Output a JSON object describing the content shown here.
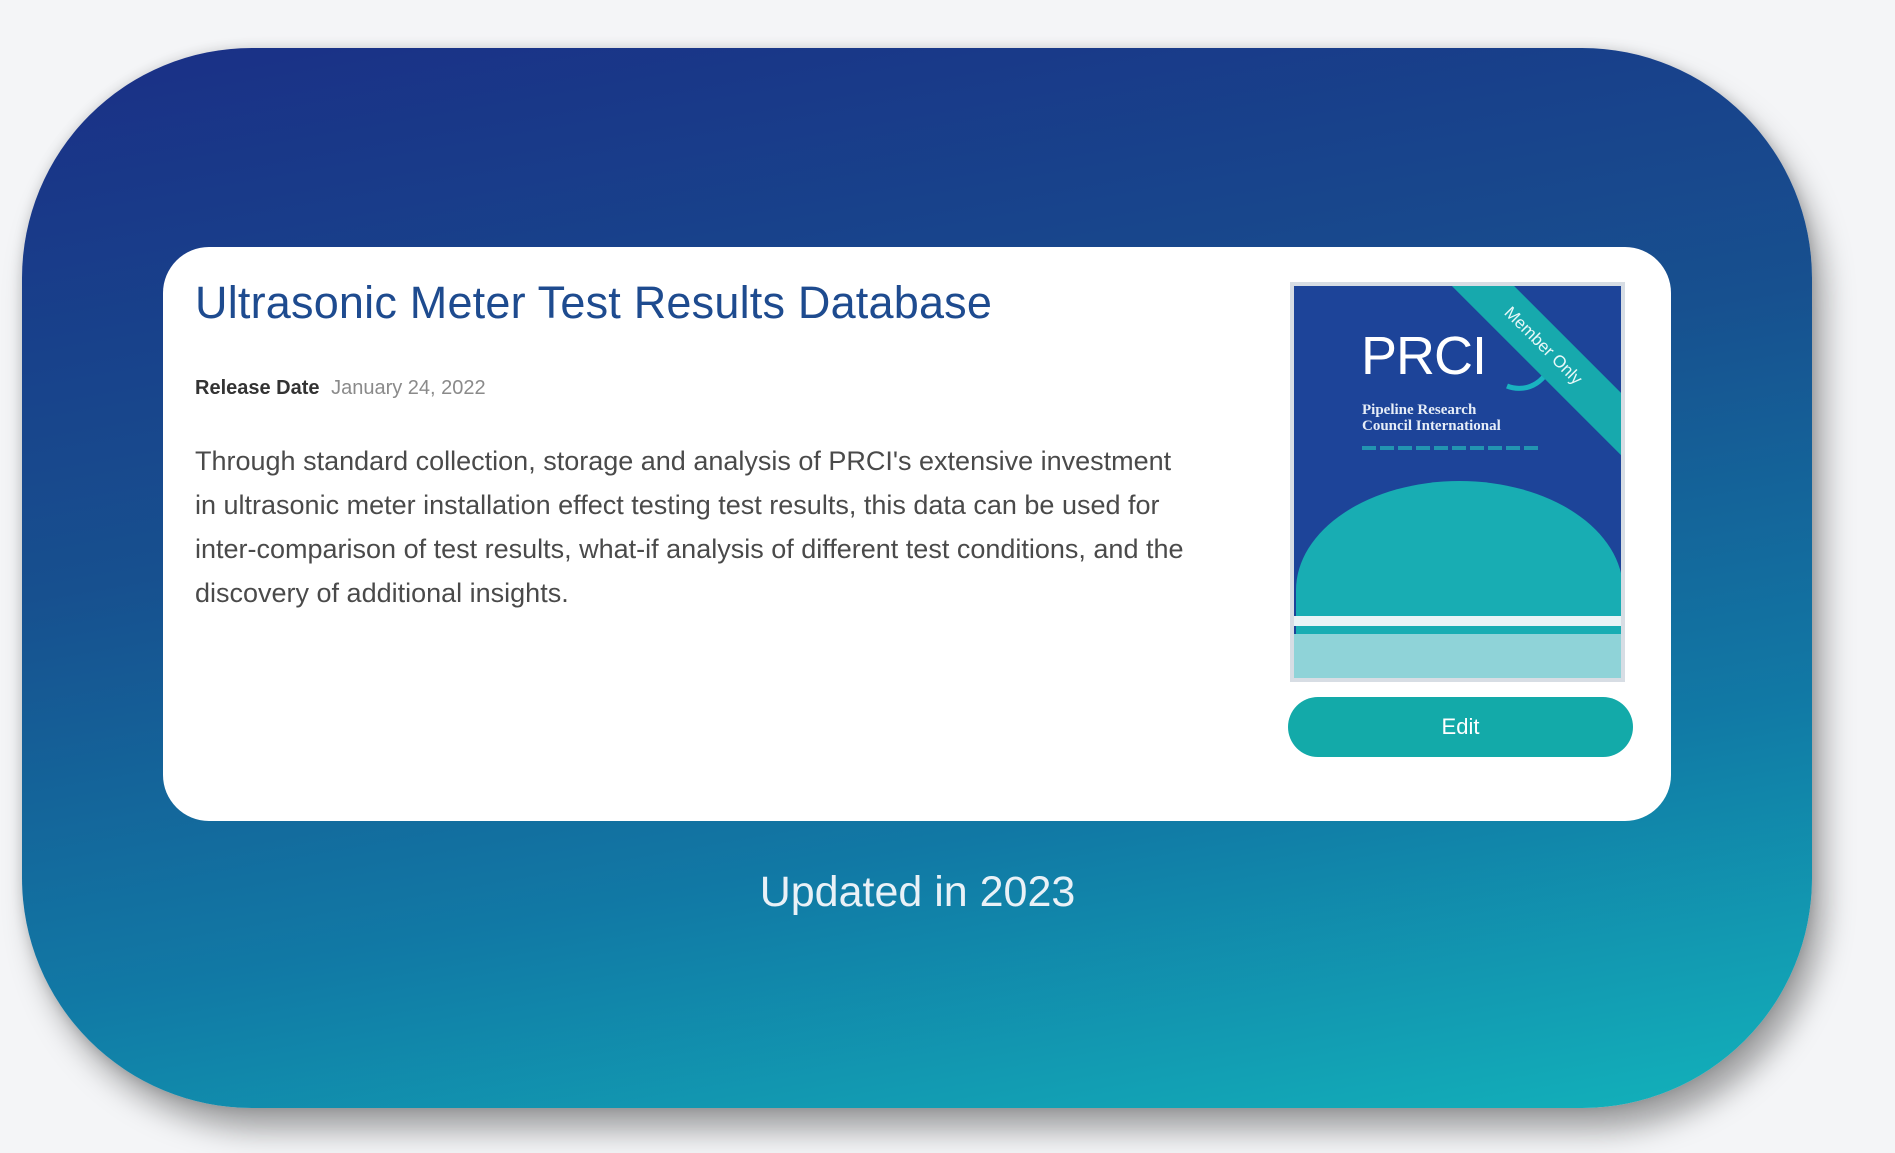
{
  "card": {
    "title": "Ultrasonic Meter Test Results Database",
    "release_label": "Release Date",
    "release_date": "January 24, 2022",
    "description": "Through standard collection, storage and analysis of PRCI's extensive investment in ultrasonic meter installation effect testing test results, this data can be used for inter-comparison of test results, what-if analysis of different test conditions, and the discovery of additional insights.",
    "cover": {
      "logo_text": "PRCI",
      "org_name": "Pipeline Research\nCouncil International",
      "ribbon": "Member Only"
    },
    "edit_label": "Edit"
  },
  "footer": {
    "updated": "Updated in 2023"
  },
  "colors": {
    "title": "#1e4b8f",
    "accent": "#13aaa9",
    "cover_blue": "#1d4499",
    "panel_top": "#1a2f86",
    "panel_bottom": "#12b3bb"
  },
  "icons": {
    "logo": "prci-logo-icon"
  }
}
